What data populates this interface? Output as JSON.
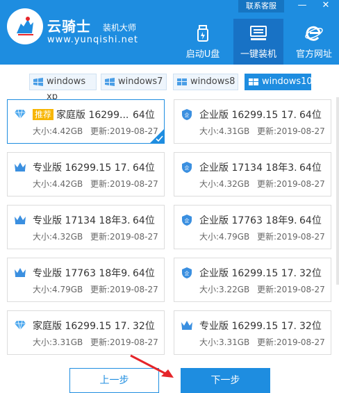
{
  "header": {
    "brand_title": "云骑士",
    "brand_sub": "装机大师",
    "brand_url": "www.yunqishi.net",
    "contact_label": "联系客服",
    "minimize_label": "—",
    "close_label": "✕"
  },
  "nav": [
    {
      "label": "启动U盘",
      "icon": "usb-drive-icon",
      "active": false
    },
    {
      "label": "一键装机",
      "icon": "install-icon",
      "active": true
    },
    {
      "label": "官方网址",
      "icon": "ie-browser-icon",
      "active": false
    }
  ],
  "tabs": [
    {
      "label": "windows xp",
      "active": false
    },
    {
      "label": "windows7",
      "active": false
    },
    {
      "label": "windows8",
      "active": false
    },
    {
      "label": "windows10",
      "active": true
    }
  ],
  "systems": [
    {
      "tag": "推荐",
      "name": "家庭版 16299...",
      "bits": "64位",
      "size": "大小:4.42GB",
      "date": "更新:2019-08-27",
      "icon": "diamond-icon",
      "selected": true
    },
    {
      "tag": "",
      "name": "企业版 16299.15 17...",
      "bits": "64位",
      "size": "大小:4.31GB",
      "date": "更新:2019-08-27",
      "icon": "enterprise-shield-icon",
      "selected": false
    },
    {
      "tag": "",
      "name": "专业版 16299.15 17...",
      "bits": "64位",
      "size": "大小:4.42GB",
      "date": "更新:2019-08-27",
      "icon": "crown-icon",
      "selected": false
    },
    {
      "tag": "",
      "name": "企业版 17134 18年3...",
      "bits": "64位",
      "size": "大小:4.32GB",
      "date": "更新:2019-08-27",
      "icon": "enterprise-shield-icon",
      "selected": false
    },
    {
      "tag": "",
      "name": "专业版 17134 18年3...",
      "bits": "64位",
      "size": "大小:4.32GB",
      "date": "更新:2019-08-27",
      "icon": "crown-icon",
      "selected": false
    },
    {
      "tag": "",
      "name": "企业版 17763 18年9...",
      "bits": "64位",
      "size": "大小:4.79GB",
      "date": "更新:2019-08-27",
      "icon": "enterprise-shield-icon",
      "selected": false
    },
    {
      "tag": "",
      "name": "专业版 17763 18年9...",
      "bits": "64位",
      "size": "大小:4.79GB",
      "date": "更新:2019-08-27",
      "icon": "crown-icon",
      "selected": false
    },
    {
      "tag": "",
      "name": "企业版 16299.15 17...",
      "bits": "32位",
      "size": "大小:3.22GB",
      "date": "更新:2019-08-27",
      "icon": "enterprise-shield-icon",
      "selected": false
    },
    {
      "tag": "",
      "name": "家庭版 16299.15 17...",
      "bits": "32位",
      "size": "大小:3.31GB",
      "date": "更新:2019-08-27",
      "icon": "diamond-icon",
      "selected": false
    },
    {
      "tag": "",
      "name": "专业版 16299.15 17...",
      "bits": "32位",
      "size": "大小:3.31GB",
      "date": "更新:2019-08-27",
      "icon": "crown-icon",
      "selected": false
    }
  ],
  "footer": {
    "prev_label": "上一步",
    "next_label": "下一步"
  },
  "colors": {
    "brand": "#1e8de0",
    "nav_active": "#1872c5",
    "tag": "#f7b500",
    "arrow": "#e5252a"
  }
}
